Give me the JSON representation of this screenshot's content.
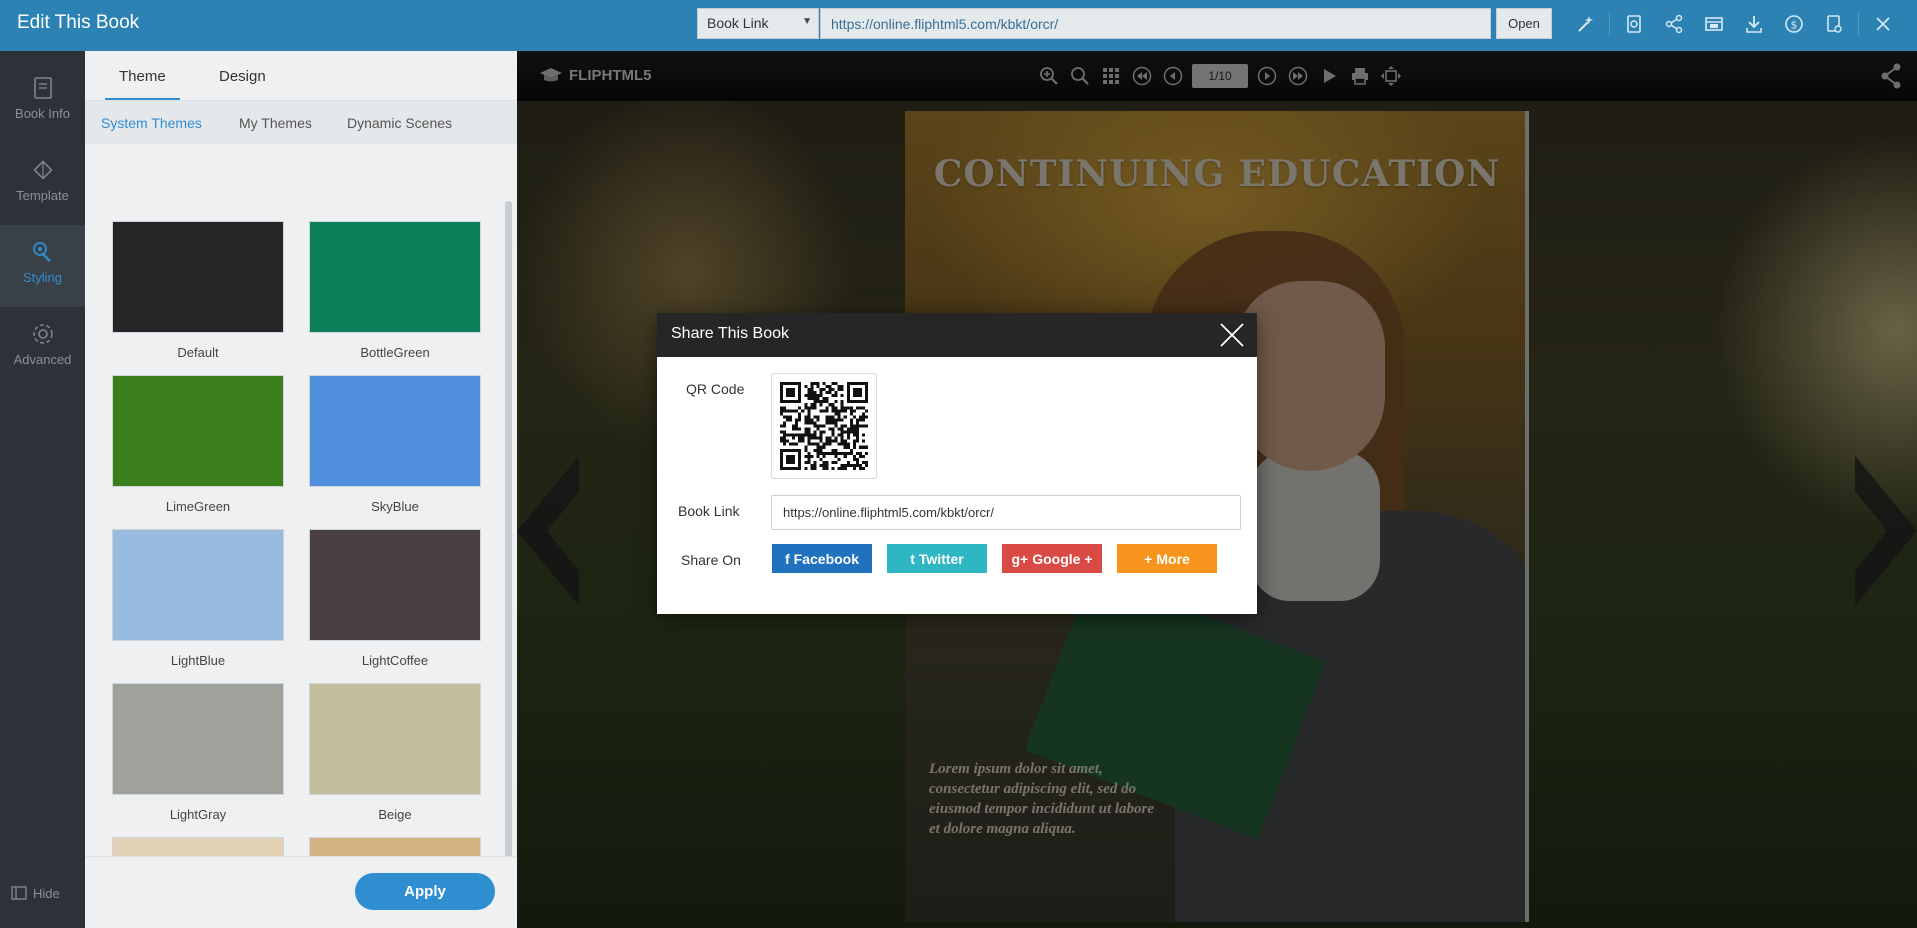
{
  "app": {
    "title": "Edit This Book"
  },
  "topbar": {
    "link_type": "Book Link",
    "url": "https://online.fliphtml5.com/kbkt/orcr/",
    "open_label": "Open",
    "icons": [
      "magic-wand-icon",
      "publish-icon",
      "share-icon",
      "embed-icon",
      "download-icon",
      "monetize-icon",
      "settings-doc-icon",
      "close-icon"
    ]
  },
  "sidebar": {
    "items": [
      {
        "label": "Book Info",
        "icon": "book-info-icon"
      },
      {
        "label": "Template",
        "icon": "template-icon"
      },
      {
        "label": "Styling",
        "icon": "styling-icon",
        "active": true
      },
      {
        "label": "Advanced",
        "icon": "advanced-gear-icon"
      }
    ],
    "hide_label": "Hide"
  },
  "panel": {
    "tabs": [
      {
        "label": "Theme",
        "active": true
      },
      {
        "label": "Design"
      }
    ],
    "subtabs": [
      {
        "label": "System Themes",
        "active": true
      },
      {
        "label": "My Themes"
      },
      {
        "label": "Dynamic Scenes"
      }
    ],
    "themes": [
      {
        "name": "Default",
        "color": "#262628"
      },
      {
        "name": "BottleGreen",
        "color": "#0c7f5a"
      },
      {
        "name": "LimeGreen",
        "color": "#3a7e1c"
      },
      {
        "name": "SkyBlue",
        "color": "#4f8fdb"
      },
      {
        "name": "LightBlue",
        "color": "#9abbe0"
      },
      {
        "name": "LightCoffee",
        "color": "#4a3f42"
      },
      {
        "name": "LightGray",
        "color": "#9fa29b"
      },
      {
        "name": "Beige",
        "color": "#c3bd9c"
      },
      {
        "name": "",
        "color": "#e4d2b6"
      },
      {
        "name": "",
        "color": "#d4b383"
      }
    ],
    "apply_label": "Apply"
  },
  "preview": {
    "brand": "FLIPHTML5",
    "page_indicator": "1/10",
    "book_title": "CONTINUING EDUCATION",
    "book_body": "Lorem ipsum dolor sit amet, consectetur adipiscing elit, sed do eiusmod tempor incididunt ut labore et dolore magna aliqua."
  },
  "dialog": {
    "title": "Share This Book",
    "qr_label": "QR Code",
    "link_label": "Book Link",
    "link_value": "https://online.fliphtml5.com/kbkt/orcr/",
    "share_label": "Share On",
    "buttons": [
      {
        "label": "Facebook",
        "icon": "f",
        "color": "#2072bf"
      },
      {
        "label": "Twitter",
        "icon": "t",
        "color": "#2fb6c3"
      },
      {
        "label": "Google +",
        "icon": "g+",
        "color": "#d94a45"
      },
      {
        "label": "More",
        "icon": "+",
        "color": "#f7941d"
      }
    ]
  }
}
